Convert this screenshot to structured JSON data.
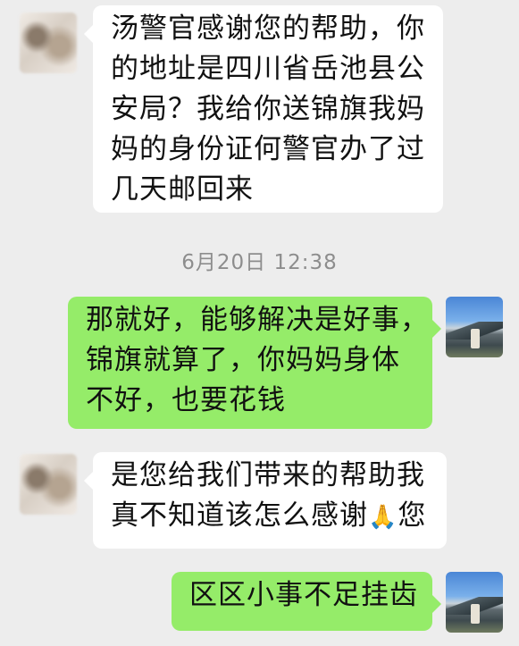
{
  "timestamp": "6月20日 12:38",
  "messages": [
    {
      "side": "in",
      "lines": [
        "汤警官感谢您的帮助，你",
        "的地址是四川省岳池县公",
        "安局？我给你送锦旗我妈",
        "妈的身份证何警官办了过",
        "几天邮回来"
      ]
    },
    {
      "side": "out",
      "lines": [
        "那就好，能够解决是好事，",
        "锦旗就算了，你妈妈身体",
        "不好，也要花钱"
      ]
    },
    {
      "side": "in",
      "line1": "是您给我们带来的帮助我",
      "line2_pre": "真不知道该怎么感谢",
      "line2_emoji": "🙏",
      "line2_post": "您"
    },
    {
      "side": "out",
      "lines": [
        "区区小事不足挂齿"
      ]
    }
  ]
}
